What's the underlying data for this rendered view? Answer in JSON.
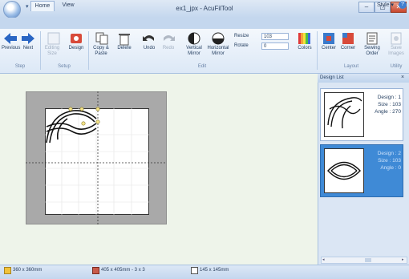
{
  "window": {
    "title": "ex1_jpx - AcuFilTool",
    "qat_arrow": "▾",
    "minimize": "–",
    "maximize": "▢",
    "close": "✕"
  },
  "tabs": {
    "home": "Home",
    "view": "View"
  },
  "style_menu": "Style ▾",
  "help": "?",
  "ribbon": {
    "previous": "Previous",
    "next": "Next",
    "editing_size": "Editing Size",
    "design": "Design",
    "copy_paste": "Copy & Paste",
    "delete": "Delete",
    "undo": "Undo",
    "redo": "Redo",
    "vertical_mirror": "Vertical Mirror",
    "horizontal_mirror": "Horizontal Mirror",
    "resize_label": "Resize",
    "resize_value": "103",
    "rotate_label": "Rotate",
    "rotate_value": "0",
    "colors": "Colors",
    "center": "Center",
    "corner": "Corner",
    "sewing_order": "Sewing Order",
    "save_images": "Save Images",
    "groups": {
      "step": "Step",
      "setup": "Setup",
      "edit": "Edit",
      "layout": "Layout",
      "utility": "Utility"
    }
  },
  "design_list": {
    "header": "Design List",
    "close": "×",
    "items": [
      {
        "design": "Design : 1",
        "size": "Size : 103",
        "angle": "Angle : 270"
      },
      {
        "design": "Design : 2",
        "size": "Size : 103",
        "angle": "Angle : 0"
      }
    ]
  },
  "status": {
    "canvas": "360 x 360mm",
    "hoop": "405 x 405mm - 3 x 3",
    "design_size": "145 x 145mm"
  },
  "colors": {
    "selected": "#3f8ad6",
    "ribbon": "#dce8f6",
    "workspace": "#eef4ea"
  }
}
